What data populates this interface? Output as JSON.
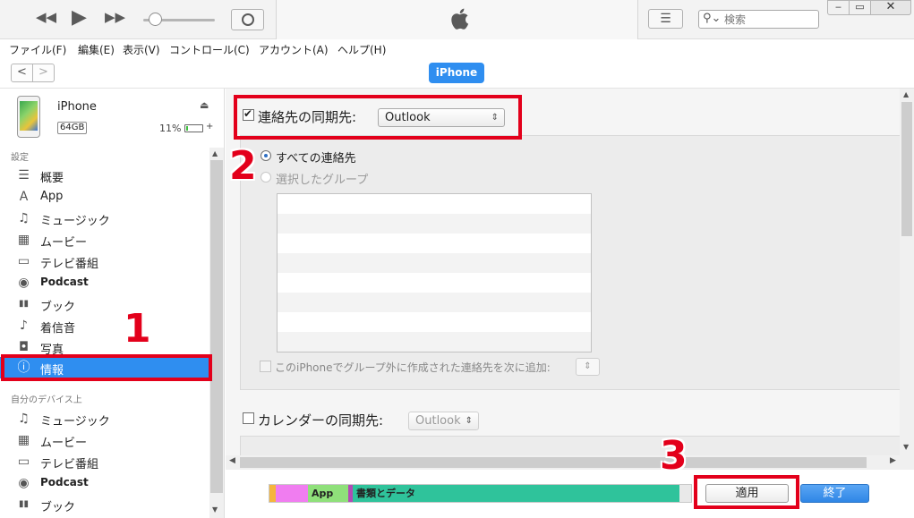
{
  "player": {
    "rewind_icon": "rewind-icon",
    "play_icon": "play-icon",
    "ffwd_icon": "fast-forward-icon",
    "airplay_icon": "airplay-icon",
    "logo": "apple-logo",
    "list_icon": "list-view-icon",
    "search_placeholder": "検索",
    "win_min": "‒",
    "win_max": "▭",
    "win_close": "✕"
  },
  "menu": {
    "items": [
      "ファイル(F)",
      "編集(E)",
      "表示(V)",
      "コントロール(C)",
      "アカウント(A)",
      "ヘルプ(H)"
    ]
  },
  "nav": {
    "back": "<",
    "forward": ">",
    "device_button": "iPhone"
  },
  "device": {
    "name": "iPhone",
    "capacity": "64GB",
    "battery": "11%",
    "eject": "⏏",
    "charging": "+"
  },
  "sidebar": {
    "settings_header": "設定",
    "settings_items": [
      {
        "label": "概要",
        "icon": "summary-icon",
        "glyph": "☰"
      },
      {
        "label": "App",
        "icon": "app-store-icon",
        "glyph": "A"
      },
      {
        "label": "ミュージック",
        "icon": "music-note-icon",
        "glyph": "♫"
      },
      {
        "label": "ムービー",
        "icon": "film-icon",
        "glyph": "▦"
      },
      {
        "label": "テレビ番組",
        "icon": "tv-icon",
        "glyph": "▭"
      },
      {
        "label": "Podcast",
        "icon": "podcast-icon",
        "glyph": "◉"
      },
      {
        "label": "ブック",
        "icon": "book-icon",
        "glyph": "▮▮"
      },
      {
        "label": "着信音",
        "icon": "bell-icon",
        "glyph": "♪"
      },
      {
        "label": "写真",
        "icon": "camera-icon",
        "glyph": "◘"
      },
      {
        "label": "情報",
        "icon": "info-icon",
        "glyph": "ⓘ"
      }
    ],
    "my_device_header": "自分のデバイス上",
    "device_items": [
      {
        "label": "ミュージック",
        "icon": "music-note-icon",
        "glyph": "♫"
      },
      {
        "label": "ムービー",
        "icon": "film-icon",
        "glyph": "▦"
      },
      {
        "label": "テレビ番組",
        "icon": "tv-icon",
        "glyph": "▭"
      },
      {
        "label": "Podcast",
        "icon": "podcast-icon",
        "glyph": "◉"
      },
      {
        "label": "ブック",
        "icon": "book-icon",
        "glyph": "▮▮"
      }
    ],
    "selected_item": "情報"
  },
  "contacts": {
    "checkbox_label": "連絡先の同期先:",
    "checked": true,
    "source_value": "Outlook",
    "radio_all": "すべての連絡先",
    "radio_selected_groups": "選択したグループ",
    "add_contacts_label": "このiPhoneでグループ外に作成された連絡先を次に追加:"
  },
  "calendars": {
    "checkbox_label": "カレンダーの同期先:",
    "checked": false,
    "source_value": "Outlook"
  },
  "capacity_bar": {
    "segments": [
      {
        "label": "",
        "color": "#f5b53c"
      },
      {
        "label": "",
        "color": "#f07df0"
      },
      {
        "label": "App",
        "color": "#8fe07a"
      },
      {
        "label": "",
        "color": "#b24bb6"
      },
      {
        "label": "書類とデータ",
        "color": "#2fc39b"
      },
      {
        "label": "",
        "color": "#e9e9e9"
      }
    ]
  },
  "buttons": {
    "apply": "適用",
    "done": "終了"
  },
  "annotations": {
    "step1": "1",
    "step2": "2",
    "step3": "3",
    "highlight_color": "#e3001b"
  },
  "colors": {
    "accent": "#2f8ef0"
  }
}
